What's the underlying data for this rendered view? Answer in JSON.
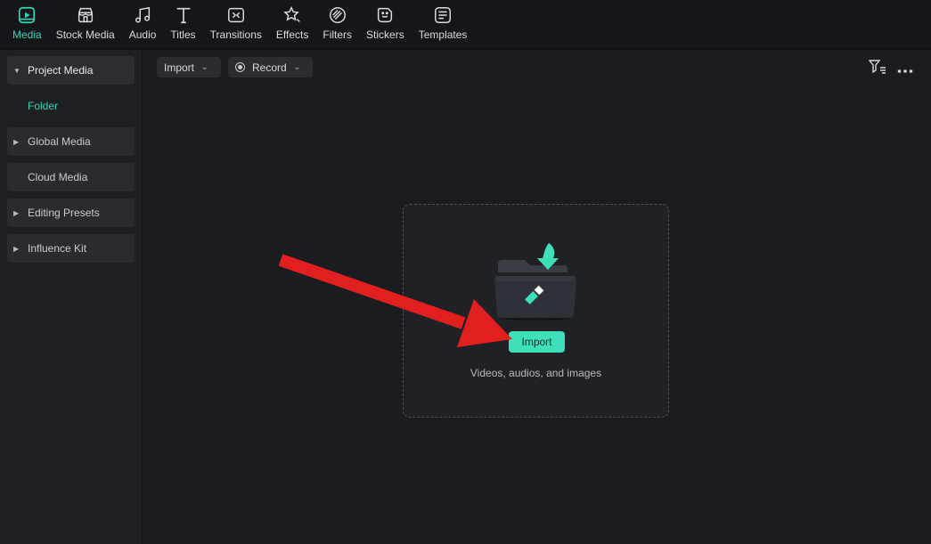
{
  "toolbar": {
    "items": [
      {
        "label": "Media",
        "icon": "media-icon",
        "active": true
      },
      {
        "label": "Stock Media",
        "icon": "stock-media-icon",
        "active": false
      },
      {
        "label": "Audio",
        "icon": "music-note-icon",
        "active": false
      },
      {
        "label": "Titles",
        "icon": "text-t-icon",
        "active": false
      },
      {
        "label": "Transitions",
        "icon": "transitions-icon",
        "active": false
      },
      {
        "label": "Effects",
        "icon": "effects-star-icon",
        "active": false
      },
      {
        "label": "Filters",
        "icon": "filters-icon",
        "active": false
      },
      {
        "label": "Stickers",
        "icon": "sticker-icon",
        "active": false
      },
      {
        "label": "Templates",
        "icon": "templates-icon",
        "active": false
      }
    ]
  },
  "sidebar": {
    "items": [
      {
        "label": "Project Media",
        "expanded": true
      },
      {
        "label": "Folder"
      },
      {
        "label": "Global Media"
      },
      {
        "label": "Cloud Media"
      },
      {
        "label": "Editing Presets"
      },
      {
        "label": "Influence Kit"
      }
    ]
  },
  "main": {
    "import_dropdown": "Import",
    "record_dropdown": "Record",
    "dropzone": {
      "button_label": "Import",
      "hint": "Videos, audios, and images"
    }
  },
  "colors": {
    "accent": "#35d6b4",
    "import_button": "#3fe0b9",
    "annotation_arrow": "#e21f1f"
  }
}
